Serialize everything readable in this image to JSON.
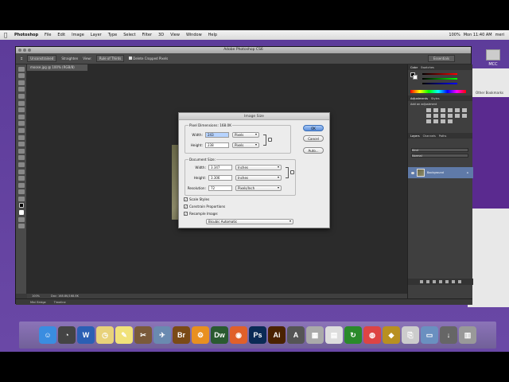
{
  "menubar": {
    "apple": "",
    "items": [
      "Photoshop",
      "File",
      "Edit",
      "Image",
      "Layer",
      "Type",
      "Select",
      "Filter",
      "3D",
      "View",
      "Window",
      "Help"
    ],
    "status": {
      "battery": "100%",
      "clock": "Mon 11:40 AM",
      "user": "meri"
    }
  },
  "desktop": {
    "mcc_label": "MCC",
    "bookmarks_label": "Other Bookmarks"
  },
  "ps": {
    "title": "Adobe Photoshop CS6",
    "options": {
      "preset": "Unconstrained",
      "straighten": "Straighten",
      "view_label": "View:",
      "view_value": "Rule of Thirds",
      "delete_cropped": "Delete Cropped Pixels",
      "workspace": "Essentials"
    },
    "doc_tab": "moose.jpg @ 100% (RGB/8)",
    "status_zoom": "100%",
    "status_doc": "Doc: 168.8K/168.8K",
    "mini_bridge": "Mini Bridge",
    "timeline": "Timeline"
  },
  "panels": {
    "color_tabs": [
      "Color",
      "Swatches"
    ],
    "adj_tabs": [
      "Adjustments",
      "Styles"
    ],
    "adj_title": "Add an adjustment",
    "layers_tabs": [
      "Layers",
      "Channels",
      "Paths"
    ],
    "layer_kind": "Kind",
    "blend_mode": "Normal",
    "layer_name": "Background"
  },
  "dialog": {
    "title": "Image Size",
    "pixel_dimensions_label": "Pixel Dimensions:",
    "pixel_dimensions_value": "168.0K",
    "width_label": "Width:",
    "height_label": "Height:",
    "px_width": "243",
    "px_height": "238",
    "px_unit": "Pixels",
    "document_size_label": "Document Size:",
    "doc_width": "3.347",
    "doc_height": "3.306",
    "doc_unit": "Inches",
    "resolution_label": "Resolution:",
    "resolution": "72",
    "resolution_unit": "Pixels/Inch",
    "ok": "OK",
    "cancel": "Cancel",
    "auto": "Auto...",
    "scale_styles": "Scale Styles",
    "constrain": "Constrain Proportions",
    "resample": "Resample Image:",
    "method": "Bicubic Automatic"
  },
  "dock": {
    "icons": [
      {
        "name": "finder-icon",
        "glyph": "☺",
        "color": "#3a8de0"
      },
      {
        "name": "dashboard-icon",
        "glyph": "◔",
        "color": "#444"
      },
      {
        "name": "word-icon",
        "glyph": "W",
        "color": "#2b5fb4"
      },
      {
        "name": "clock-icon",
        "glyph": "◷",
        "color": "#e8d27a"
      },
      {
        "name": "stickies-icon",
        "glyph": "✎",
        "color": "#f1e27a"
      },
      {
        "name": "tools-icon",
        "glyph": "✂",
        "color": "#7a5a3a"
      },
      {
        "name": "preview-icon",
        "glyph": "✈",
        "color": "#6a8ab0"
      },
      {
        "name": "bridge-icon",
        "glyph": "Br",
        "color": "#7a4a16"
      },
      {
        "name": "settings-icon",
        "glyph": "⚙",
        "color": "#e89020"
      },
      {
        "name": "dreamweaver-icon",
        "glyph": "Dw",
        "color": "#2a5a30"
      },
      {
        "name": "firefox-icon",
        "glyph": "◉",
        "color": "#e0602a"
      },
      {
        "name": "photoshop-icon",
        "glyph": "Ps",
        "color": "#0a2a55"
      },
      {
        "name": "illustrator-icon",
        "glyph": "Ai",
        "color": "#4a2200"
      },
      {
        "name": "text-icon",
        "glyph": "A",
        "color": "#555"
      },
      {
        "name": "grid-icon",
        "glyph": "▦",
        "color": "#aaa"
      },
      {
        "name": "calculator-icon",
        "glyph": "▤",
        "color": "#ddd"
      },
      {
        "name": "sync-icon",
        "glyph": "↻",
        "color": "#2a8a2a"
      },
      {
        "name": "chrome-icon",
        "glyph": "◍",
        "color": "#d44"
      },
      {
        "name": "shield-icon",
        "glyph": "◆",
        "color": "#b89020"
      },
      {
        "name": "pdf-icon",
        "glyph": "⎘",
        "color": "#ccc"
      },
      {
        "name": "folder-icon",
        "glyph": "▭",
        "color": "#6a90c0"
      },
      {
        "name": "download-icon",
        "glyph": "↓",
        "color": "#666"
      },
      {
        "name": "trash-icon",
        "glyph": "▥",
        "color": "#999"
      }
    ]
  }
}
